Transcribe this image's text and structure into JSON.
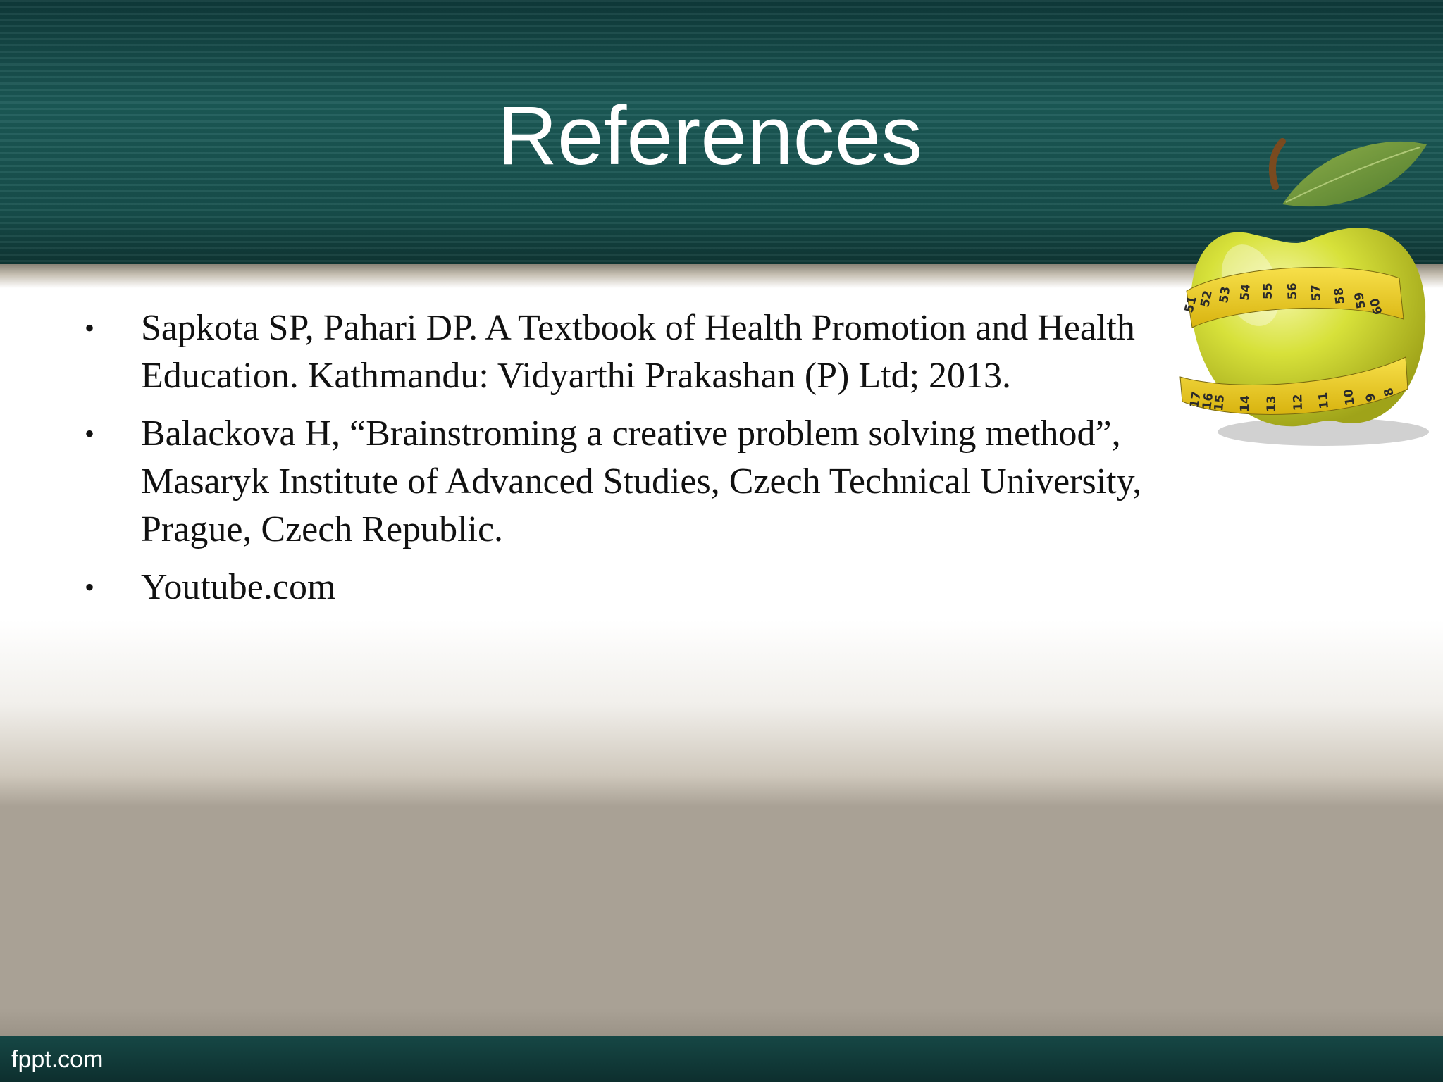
{
  "slide": {
    "title": "References",
    "references": [
      {
        "bullet": "•",
        "lines": [
          "Sapkota SP, Pahari DP. A Textbook of Health Promotion and Health",
          "Education. Kathmandu: Vidyarthi Prakashan (P) Ltd; 2013."
        ]
      },
      {
        "bullet": "•",
        "lines": [
          "Balackova H, “Brainstroming a creative problem solving method”,",
          "Masaryk Institute of Advanced Studies, Czech Technical University,",
          "Prague, Czech Republic."
        ]
      },
      {
        "bullet": "•",
        "lines": [
          "Youtube.com"
        ]
      }
    ],
    "decoration": {
      "icon": "apple-with-measuring-tape-icon",
      "tape_numbers_top": [
        "51",
        "52",
        "53",
        "54",
        "55",
        "56",
        "57",
        "58",
        "59",
        "60"
      ],
      "tape_numbers_bottom": [
        "17",
        "16",
        "15",
        "14",
        "13",
        "12",
        "11",
        "10",
        "9",
        "8"
      ]
    },
    "footer": "fppt.com"
  },
  "colors": {
    "header": "#17504d",
    "title_text": "#ffffff",
    "body_text": "#111111",
    "apple": "#d8e23a",
    "tape": "#f2d019"
  }
}
